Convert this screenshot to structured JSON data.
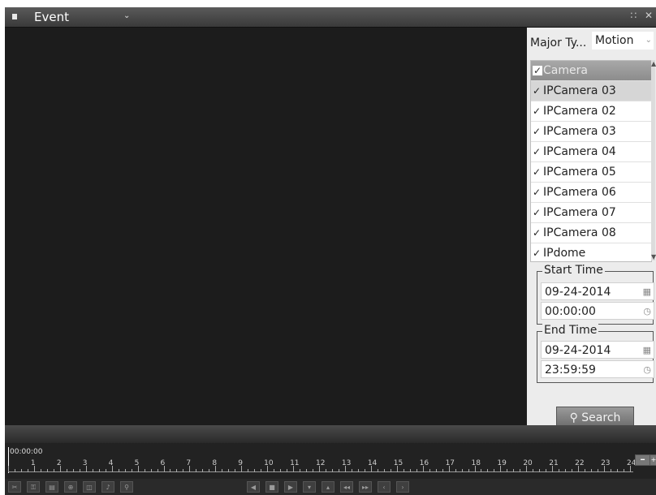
{
  "titlebar": {
    "title": "Event",
    "dropdown": "⌄",
    "buttons": [
      "∷",
      "✕"
    ]
  },
  "panel": {
    "major_type_label": "Major Ty...",
    "major_type_value": "Motion",
    "camera_header": "Camera",
    "cameras": [
      "IPCamera 03",
      "IPCamera 02",
      "IPCamera 03",
      "IPCamera 04",
      "IPCamera 05",
      "IPCamera 06",
      "IPCamera 07",
      "IPCamera 08",
      "IPdome"
    ],
    "start_time_label": "Start Time",
    "start_date": "09-24-2014",
    "start_clock": "00:00:00",
    "end_time_label": "End Time",
    "end_date": "09-24-2014",
    "end_clock": "23:59:59",
    "search_label": "Search"
  },
  "timeline": {
    "start_time": "00:00:00",
    "hours": [
      "1",
      "2",
      "3",
      "4",
      "5",
      "6",
      "7",
      "8",
      "9",
      "10",
      "11",
      "12",
      "13",
      "14",
      "15",
      "16",
      "17",
      "18",
      "19",
      "20",
      "21",
      "22",
      "23",
      "24"
    ]
  },
  "toolbar": {
    "left_icons": [
      "clip-icon",
      "lock-icon",
      "save-icon",
      "digital-zoom-icon",
      "snapshot-icon",
      "audio-icon",
      "zoom-icon"
    ],
    "center_icons": [
      "reverse-play-icon",
      "stop-icon",
      "play-icon",
      "slow-icon",
      "fast-icon",
      "skip-back-icon",
      "skip-forward-icon",
      "prev-day-icon",
      "next-day-icon"
    ]
  },
  "colors": {
    "background": "#1f1f1f",
    "panel": "#ececec",
    "header_gray": "#8c8c8c"
  }
}
